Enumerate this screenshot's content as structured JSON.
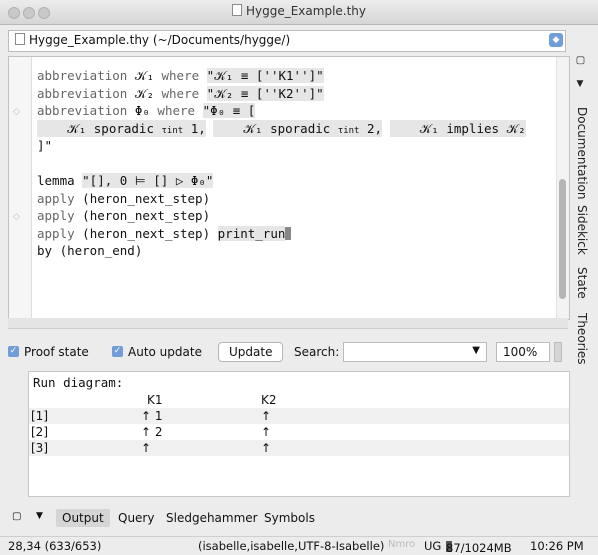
{
  "window": {
    "title": "Hygge_Example.thy"
  },
  "buffer": {
    "label": "Hygge_Example.thy (~/Documents/hygge/)"
  },
  "dock_tabs": [
    "Documentation",
    "Sidekick",
    "State",
    "Theories"
  ],
  "editor": {
    "lines": [
      "abbreviation 𝒦₁ where \"𝒦₁ ≡ [''K1'']\"",
      "abbreviation 𝒦₂ where \"𝒦₂ ≡ [''K2'']\"",
      "abbreviation Φ₀ where \"Φ₀ ≡ [",
      "    𝒦₁ sporadic τ_int 1,",
      "    𝒦₁ sporadic τ_int 2,",
      "    𝒦₁ implies 𝒦₂",
      "]\"",
      "",
      "lemma \"[], 0 ⊨ [] ▷ Φ₀\"",
      "apply (heron_next_step)",
      "apply (heron_next_step)",
      "apply (heron_next_step) print_run",
      "by (heron_end)"
    ]
  },
  "panel": {
    "proof_state": "Proof state",
    "auto_update": "Auto update",
    "update": "Update",
    "search": "Search:",
    "zoom": "100%"
  },
  "output": {
    "title": "Run diagram:",
    "headers": [
      "K1",
      "K2"
    ],
    "rows": [
      {
        "label": "[1]",
        "k1": "↑ 1",
        "k2": "↑"
      },
      {
        "label": "[2]",
        "k1": "↑ 2",
        "k2": "↑"
      },
      {
        "label": "[3]",
        "k1": "↑",
        "k2": "↑"
      }
    ]
  },
  "bottom_tabs": [
    "Output",
    "Query",
    "Sledgehammer",
    "Symbols"
  ],
  "status": {
    "position": "28,34 (633/653)",
    "mode": "(isabelle,isabelle,UTF-8-Isabelle)",
    "flags": "Nmro",
    "ug": "UG",
    "memory": "87/1024MB",
    "time": "10:26 PM"
  },
  "colors": {
    "accent": "#6f9ed8",
    "keyword": "#666666",
    "shade": "#e6e6e6"
  }
}
